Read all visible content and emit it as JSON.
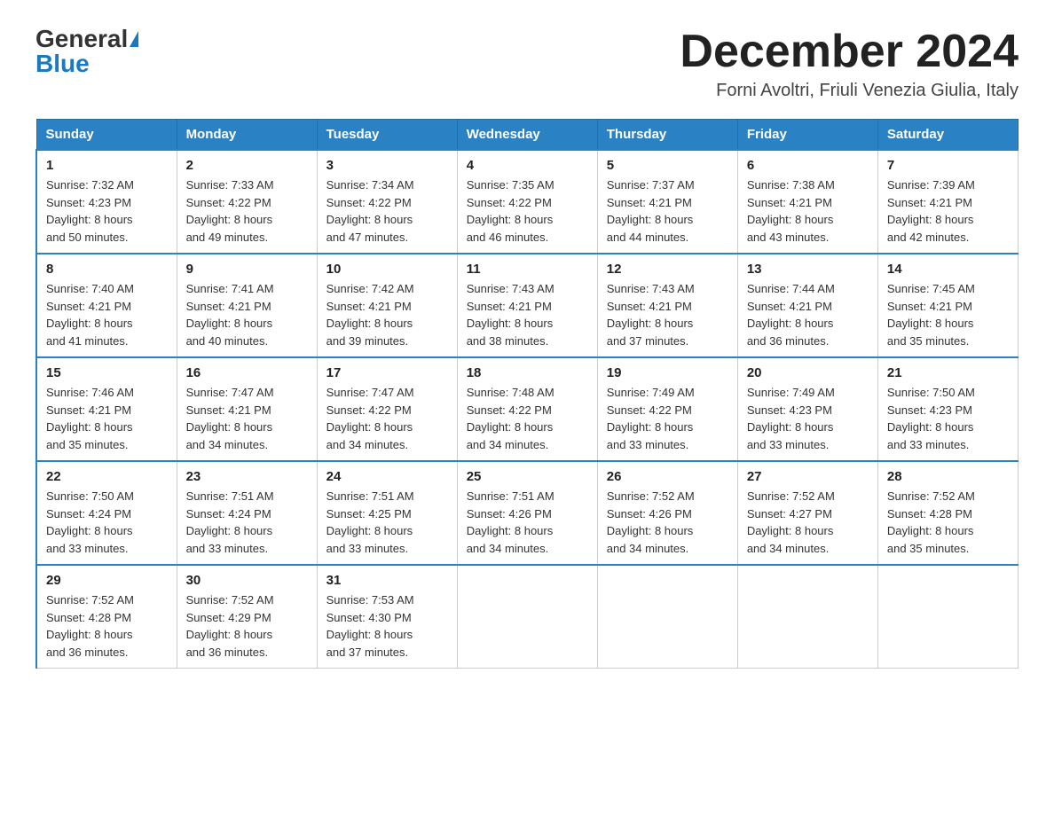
{
  "header": {
    "logo_general": "General",
    "logo_blue": "Blue",
    "month_title": "December 2024",
    "location": "Forni Avoltri, Friuli Venezia Giulia, Italy"
  },
  "weekdays": [
    "Sunday",
    "Monday",
    "Tuesday",
    "Wednesday",
    "Thursday",
    "Friday",
    "Saturday"
  ],
  "weeks": [
    [
      {
        "day": "1",
        "sunrise": "7:32 AM",
        "sunset": "4:23 PM",
        "daylight": "8 hours and 50 minutes."
      },
      {
        "day": "2",
        "sunrise": "7:33 AM",
        "sunset": "4:22 PM",
        "daylight": "8 hours and 49 minutes."
      },
      {
        "day": "3",
        "sunrise": "7:34 AM",
        "sunset": "4:22 PM",
        "daylight": "8 hours and 47 minutes."
      },
      {
        "day": "4",
        "sunrise": "7:35 AM",
        "sunset": "4:22 PM",
        "daylight": "8 hours and 46 minutes."
      },
      {
        "day": "5",
        "sunrise": "7:37 AM",
        "sunset": "4:21 PM",
        "daylight": "8 hours and 44 minutes."
      },
      {
        "day": "6",
        "sunrise": "7:38 AM",
        "sunset": "4:21 PM",
        "daylight": "8 hours and 43 minutes."
      },
      {
        "day": "7",
        "sunrise": "7:39 AM",
        "sunset": "4:21 PM",
        "daylight": "8 hours and 42 minutes."
      }
    ],
    [
      {
        "day": "8",
        "sunrise": "7:40 AM",
        "sunset": "4:21 PM",
        "daylight": "8 hours and 41 minutes."
      },
      {
        "day": "9",
        "sunrise": "7:41 AM",
        "sunset": "4:21 PM",
        "daylight": "8 hours and 40 minutes."
      },
      {
        "day": "10",
        "sunrise": "7:42 AM",
        "sunset": "4:21 PM",
        "daylight": "8 hours and 39 minutes."
      },
      {
        "day": "11",
        "sunrise": "7:43 AM",
        "sunset": "4:21 PM",
        "daylight": "8 hours and 38 minutes."
      },
      {
        "day": "12",
        "sunrise": "7:43 AM",
        "sunset": "4:21 PM",
        "daylight": "8 hours and 37 minutes."
      },
      {
        "day": "13",
        "sunrise": "7:44 AM",
        "sunset": "4:21 PM",
        "daylight": "8 hours and 36 minutes."
      },
      {
        "day": "14",
        "sunrise": "7:45 AM",
        "sunset": "4:21 PM",
        "daylight": "8 hours and 35 minutes."
      }
    ],
    [
      {
        "day": "15",
        "sunrise": "7:46 AM",
        "sunset": "4:21 PM",
        "daylight": "8 hours and 35 minutes."
      },
      {
        "day": "16",
        "sunrise": "7:47 AM",
        "sunset": "4:21 PM",
        "daylight": "8 hours and 34 minutes."
      },
      {
        "day": "17",
        "sunrise": "7:47 AM",
        "sunset": "4:22 PM",
        "daylight": "8 hours and 34 minutes."
      },
      {
        "day": "18",
        "sunrise": "7:48 AM",
        "sunset": "4:22 PM",
        "daylight": "8 hours and 34 minutes."
      },
      {
        "day": "19",
        "sunrise": "7:49 AM",
        "sunset": "4:22 PM",
        "daylight": "8 hours and 33 minutes."
      },
      {
        "day": "20",
        "sunrise": "7:49 AM",
        "sunset": "4:23 PM",
        "daylight": "8 hours and 33 minutes."
      },
      {
        "day": "21",
        "sunrise": "7:50 AM",
        "sunset": "4:23 PM",
        "daylight": "8 hours and 33 minutes."
      }
    ],
    [
      {
        "day": "22",
        "sunrise": "7:50 AM",
        "sunset": "4:24 PM",
        "daylight": "8 hours and 33 minutes."
      },
      {
        "day": "23",
        "sunrise": "7:51 AM",
        "sunset": "4:24 PM",
        "daylight": "8 hours and 33 minutes."
      },
      {
        "day": "24",
        "sunrise": "7:51 AM",
        "sunset": "4:25 PM",
        "daylight": "8 hours and 33 minutes."
      },
      {
        "day": "25",
        "sunrise": "7:51 AM",
        "sunset": "4:26 PM",
        "daylight": "8 hours and 34 minutes."
      },
      {
        "day": "26",
        "sunrise": "7:52 AM",
        "sunset": "4:26 PM",
        "daylight": "8 hours and 34 minutes."
      },
      {
        "day": "27",
        "sunrise": "7:52 AM",
        "sunset": "4:27 PM",
        "daylight": "8 hours and 34 minutes."
      },
      {
        "day": "28",
        "sunrise": "7:52 AM",
        "sunset": "4:28 PM",
        "daylight": "8 hours and 35 minutes."
      }
    ],
    [
      {
        "day": "29",
        "sunrise": "7:52 AM",
        "sunset": "4:28 PM",
        "daylight": "8 hours and 36 minutes."
      },
      {
        "day": "30",
        "sunrise": "7:52 AM",
        "sunset": "4:29 PM",
        "daylight": "8 hours and 36 minutes."
      },
      {
        "day": "31",
        "sunrise": "7:53 AM",
        "sunset": "4:30 PM",
        "daylight": "8 hours and 37 minutes."
      },
      null,
      null,
      null,
      null
    ]
  ],
  "labels": {
    "sunrise": "Sunrise:",
    "sunset": "Sunset:",
    "daylight": "Daylight:"
  }
}
